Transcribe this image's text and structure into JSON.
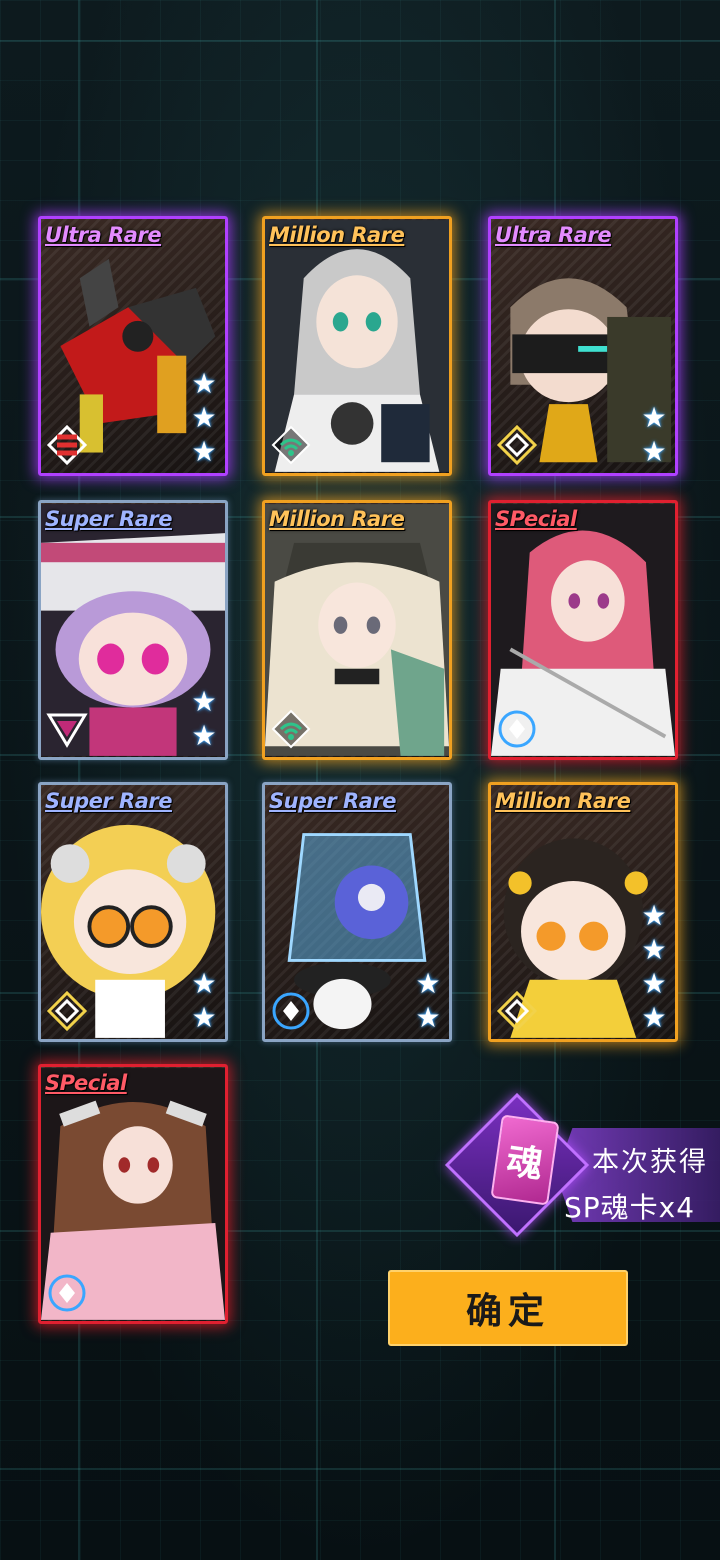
{
  "cards": [
    {
      "rarity": "Ultra Rare",
      "type": "ultra",
      "stars": 3,
      "emblem": "chevron-emblem",
      "subject": "red-mech"
    },
    {
      "rarity": "Million Rare",
      "type": "million",
      "stars": 0,
      "emblem": "signal-emblem",
      "subject": "silver-hair-girl"
    },
    {
      "rarity": "Ultra Rare",
      "type": "ultra",
      "stars": 2,
      "emblem": "diamond-emblem",
      "subject": "masked-girl"
    },
    {
      "rarity": "Super Rare",
      "type": "super",
      "stars": 2,
      "emblem": "triangle-emblem",
      "subject": "purple-helmet-chibi"
    },
    {
      "rarity": "Million Rare",
      "type": "million",
      "stars": 0,
      "emblem": "signal-emblem",
      "subject": "blonde-cap-girl"
    },
    {
      "rarity": "SPecial",
      "type": "special",
      "stars": 0,
      "emblem": "circle-emblem",
      "subject": "pink-hair-swordswoman"
    },
    {
      "rarity": "Super Rare",
      "type": "super",
      "stars": 2,
      "emblem": "diamond-emblem",
      "subject": "blonde-glasses-chibi"
    },
    {
      "rarity": "Super Rare",
      "type": "super",
      "stars": 2,
      "emblem": "circle-emblem",
      "subject": "jar-penguin"
    },
    {
      "rarity": "Million Rare",
      "type": "million",
      "stars": 4,
      "emblem": "diamond-emblem",
      "subject": "yellow-dress-chibi"
    },
    {
      "rarity": "SPecial",
      "type": "special",
      "stars": 0,
      "emblem": "circle-emblem",
      "subject": "brown-hair-kimono-girl"
    }
  ],
  "reward": {
    "icon_char": "魂",
    "label": "本次获得",
    "count_text": "SP魂卡x4"
  },
  "confirm_label": "确定",
  "star_glyph": "★",
  "colors": {
    "accent": "#fcaf1c",
    "ultra": "#b040ff",
    "million": "#f0a020",
    "super": "#8aa4c4",
    "special": "#e02030"
  }
}
